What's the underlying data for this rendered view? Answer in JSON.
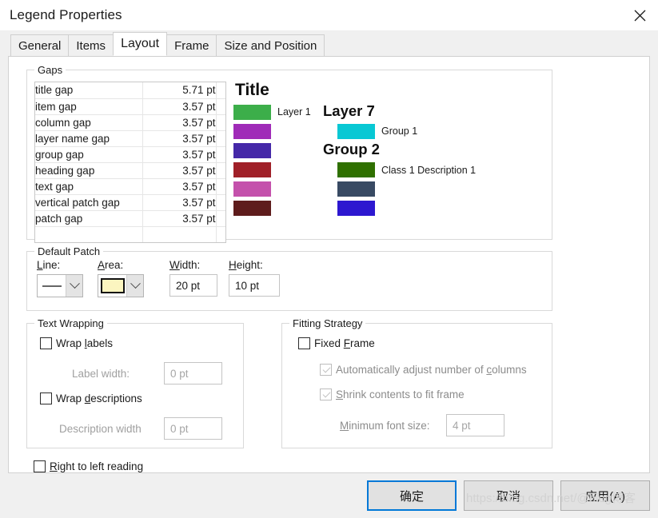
{
  "window": {
    "title": "Legend Properties",
    "close_icon": "close-icon"
  },
  "tabs": [
    {
      "label": "General",
      "active": false
    },
    {
      "label": "Items",
      "active": false
    },
    {
      "label": "Layout",
      "active": true
    },
    {
      "label": "Frame",
      "active": false
    },
    {
      "label": "Size and Position",
      "active": false
    }
  ],
  "gaps": {
    "title": "Gaps",
    "rows": [
      {
        "name": "title gap",
        "value": "5.71 pt"
      },
      {
        "name": "item gap",
        "value": "3.57 pt"
      },
      {
        "name": "column gap",
        "value": "3.57 pt"
      },
      {
        "name": "layer name gap",
        "value": "3.57 pt"
      },
      {
        "name": "group gap",
        "value": "3.57 pt"
      },
      {
        "name": "heading gap",
        "value": "3.57 pt"
      },
      {
        "name": "text gap",
        "value": "3.57 pt"
      },
      {
        "name": "vertical patch gap",
        "value": "3.57 pt"
      },
      {
        "name": "patch gap",
        "value": "3.57 pt"
      },
      {
        "name": "",
        "value": ""
      }
    ]
  },
  "preview": {
    "title": "Title",
    "left_column": {
      "first_label": "Layer 1",
      "patches": [
        "#3cae4a",
        "#a02bb8",
        "#4528a8",
        "#a02028",
        "#c451ac",
        "#5e1c1c"
      ]
    },
    "right_column": {
      "heading_1": "Layer 7",
      "item_1_label": "Group 1",
      "item_1_color": "#08c8d4",
      "heading_2": "Group 2",
      "item_2_label": "Class 1  Description 1",
      "item_2_color": "#2f7000",
      "patch_3_color": "#384a63",
      "patch_4_color": "#2d18d0"
    }
  },
  "default_patch": {
    "title": "Default Patch",
    "line_label": "Line:",
    "line_label_accesskey": "L",
    "area_label": "Area:",
    "area_label_accesskey": "A",
    "area_color": "#fbf5c0",
    "width_label": "Width:",
    "width_label_accesskey": "W",
    "width_value": "20 pt",
    "height_label": "Height:",
    "height_label_accesskey": "H",
    "height_value": "10 pt"
  },
  "text_wrapping": {
    "title": "Text Wrapping",
    "wrap_labels": {
      "label_pre": "Wrap ",
      "label_key": "l",
      "label_post": "abels",
      "checked": false
    },
    "label_width": {
      "label": "Label width:",
      "value": "0 pt",
      "enabled": false
    },
    "wrap_descriptions": {
      "label_pre": "Wrap ",
      "label_key": "d",
      "label_post": "escriptions",
      "checked": false
    },
    "description_width": {
      "label": "Description width",
      "value": "0 pt",
      "enabled": false
    }
  },
  "fitting_strategy": {
    "title": "Fitting Strategy",
    "fixed_frame": {
      "label_pre": "Fixed ",
      "label_key": "F",
      "label_post": "rame",
      "checked": false
    },
    "auto_adjust_columns": {
      "label_pre": "Automatically adjust number of ",
      "label_key": "c",
      "label_post": "olumns",
      "checked": true,
      "enabled": false
    },
    "shrink_contents": {
      "label_pre": "",
      "label_key": "S",
      "label_post": "hrink contents to fit frame",
      "checked": true,
      "enabled": false
    },
    "minimum_font_size": {
      "label_pre": "",
      "label_key": "M",
      "label_post": "inimum font size:",
      "value": "4 pt",
      "enabled": false
    }
  },
  "right_to_left": {
    "label_pre": "",
    "label_key": "R",
    "label_post": "ight to left reading",
    "checked": false
  },
  "footer": {
    "ok_label": "确定",
    "cancel_label": "取消",
    "apply_label": "应用(A)",
    "watermark": "https://blog.csdn.net/@blog博客",
    "accent_color": "#0078d7"
  }
}
